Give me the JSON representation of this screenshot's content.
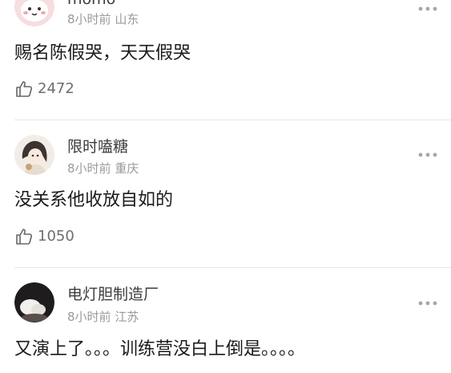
{
  "comments": [
    {
      "username": "momo",
      "time": "8小时前",
      "location": "山东",
      "text": "赐名陈假哭，天天假哭",
      "likes": "2472",
      "avatar_icon": "cartoon-face-avatar-icon"
    },
    {
      "username": "限时嗑糖",
      "time": "8小时前",
      "location": "重庆",
      "text": "没关系他收放自如的",
      "likes": "1050",
      "avatar_icon": "illustrated-girl-avatar-icon"
    },
    {
      "username": "电灯胆制造厂",
      "time": "8小时前",
      "location": "江苏",
      "text": "又演上了。。。训练营没白上倒是。。。。",
      "likes": "",
      "avatar_icon": "white-figure-dark-avatar-icon"
    }
  ]
}
